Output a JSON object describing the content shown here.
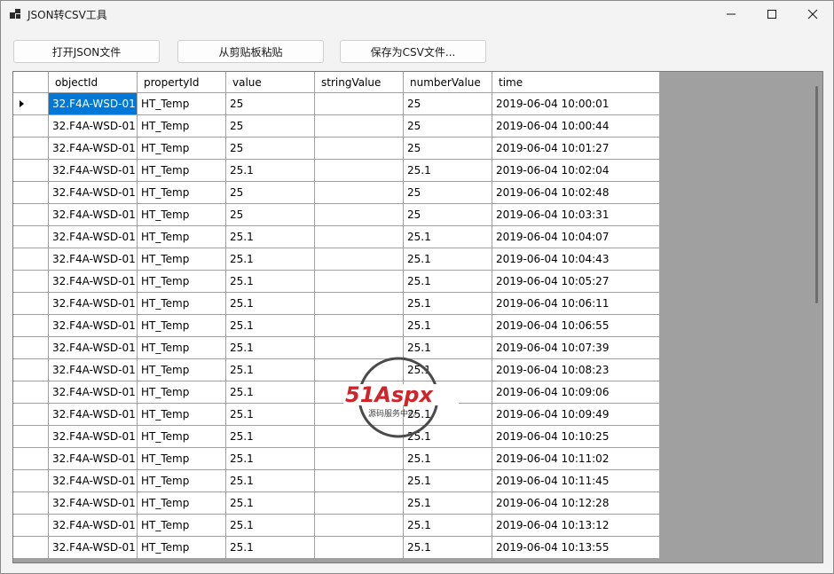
{
  "window": {
    "title": "JSON转CSV工具"
  },
  "toolbar": {
    "open_label": "打开JSON文件",
    "paste_label": "从剪贴板粘贴",
    "save_label": "保存为CSV文件..."
  },
  "grid": {
    "columns": [
      "objectId",
      "propertyId",
      "value",
      "stringValue",
      "numberValue",
      "time"
    ],
    "selected_row": 0,
    "selected_col": 0,
    "rows": [
      [
        "32.F4A-WSD-01",
        "HT_Temp",
        "25",
        "",
        "25",
        "2019-06-04 10:00:01"
      ],
      [
        "32.F4A-WSD-01",
        "HT_Temp",
        "25",
        "",
        "25",
        "2019-06-04 10:00:44"
      ],
      [
        "32.F4A-WSD-01",
        "HT_Temp",
        "25",
        "",
        "25",
        "2019-06-04 10:01:27"
      ],
      [
        "32.F4A-WSD-01",
        "HT_Temp",
        "25.1",
        "",
        "25.1",
        "2019-06-04 10:02:04"
      ],
      [
        "32.F4A-WSD-01",
        "HT_Temp",
        "25",
        "",
        "25",
        "2019-06-04 10:02:48"
      ],
      [
        "32.F4A-WSD-01",
        "HT_Temp",
        "25",
        "",
        "25",
        "2019-06-04 10:03:31"
      ],
      [
        "32.F4A-WSD-01",
        "HT_Temp",
        "25.1",
        "",
        "25.1",
        "2019-06-04 10:04:07"
      ],
      [
        "32.F4A-WSD-01",
        "HT_Temp",
        "25.1",
        "",
        "25.1",
        "2019-06-04 10:04:43"
      ],
      [
        "32.F4A-WSD-01",
        "HT_Temp",
        "25.1",
        "",
        "25.1",
        "2019-06-04 10:05:27"
      ],
      [
        "32.F4A-WSD-01",
        "HT_Temp",
        "25.1",
        "",
        "25.1",
        "2019-06-04 10:06:11"
      ],
      [
        "32.F4A-WSD-01",
        "HT_Temp",
        "25.1",
        "",
        "25.1",
        "2019-06-04 10:06:55"
      ],
      [
        "32.F4A-WSD-01",
        "HT_Temp",
        "25.1",
        "",
        "25.1",
        "2019-06-04 10:07:39"
      ],
      [
        "32.F4A-WSD-01",
        "HT_Temp",
        "25.1",
        "",
        "25.1",
        "2019-06-04 10:08:23"
      ],
      [
        "32.F4A-WSD-01",
        "HT_Temp",
        "25.1",
        "",
        "25.1",
        "2019-06-04 10:09:06"
      ],
      [
        "32.F4A-WSD-01",
        "HT_Temp",
        "25.1",
        "",
        "25.1",
        "2019-06-04 10:09:49"
      ],
      [
        "32.F4A-WSD-01",
        "HT_Temp",
        "25.1",
        "",
        "25.1",
        "2019-06-04 10:10:25"
      ],
      [
        "32.F4A-WSD-01",
        "HT_Temp",
        "25.1",
        "",
        "25.1",
        "2019-06-04 10:11:02"
      ],
      [
        "32.F4A-WSD-01",
        "HT_Temp",
        "25.1",
        "",
        "25.1",
        "2019-06-04 10:11:45"
      ],
      [
        "32.F4A-WSD-01",
        "HT_Temp",
        "25.1",
        "",
        "25.1",
        "2019-06-04 10:12:28"
      ],
      [
        "32.F4A-WSD-01",
        "HT_Temp",
        "25.1",
        "",
        "25.1",
        "2019-06-04 10:13:12"
      ],
      [
        "32.F4A-WSD-01",
        "HT_Temp",
        "25.1",
        "",
        "25.1",
        "2019-06-04 10:13:55"
      ]
    ]
  },
  "watermark": {
    "logo_text": "51Aspx",
    "sub_text": "源码服务中心"
  },
  "colors": {
    "selection": "#0078d7",
    "grid_background": "#a0a0a0",
    "watermark_red": "#d0242b",
    "watermark_green": "#2e8b3a"
  }
}
